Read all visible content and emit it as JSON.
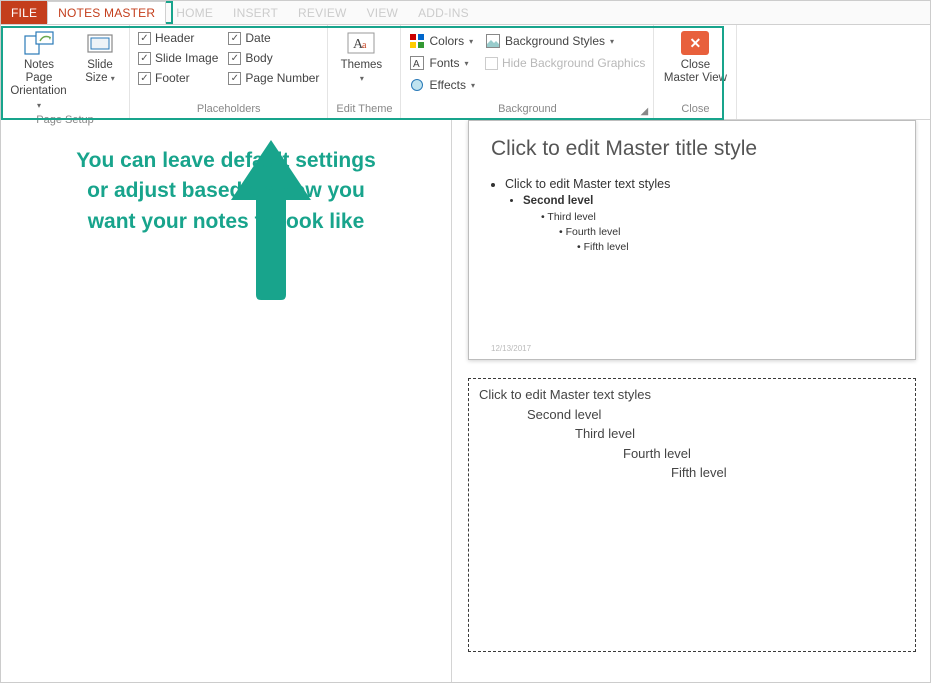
{
  "tabs": {
    "file": "FILE",
    "notes_master": "NOTES MASTER",
    "home": "HOME",
    "insert": "INSERT",
    "review": "REVIEW",
    "view": "VIEW",
    "addins": "ADD-INS"
  },
  "ribbon": {
    "page_setup": {
      "notes_orientation": "Notes Page Orientation",
      "slide_size": "Slide Size",
      "label": "Page Setup"
    },
    "placeholders": {
      "header": "Header",
      "slide_image": "Slide Image",
      "footer": "Footer",
      "date": "Date",
      "body": "Body",
      "page_number": "Page Number",
      "label": "Placeholders"
    },
    "edit_theme": {
      "themes": "Themes",
      "label": "Edit Theme"
    },
    "background": {
      "colors": "Colors",
      "fonts": "Fonts",
      "effects": "Effects",
      "bg_styles": "Background Styles",
      "hide_bg": "Hide Background Graphics",
      "label": "Background"
    },
    "close": {
      "close_master": "Close Master View",
      "label": "Close"
    }
  },
  "annotation": {
    "text": "You can leave default settings or adjust based on how you want your notes to look like"
  },
  "slide": {
    "title": "Click to edit Master title style",
    "body_l1": "Click to edit Master text styles",
    "body_l2": "Second level",
    "body_l3": "Third level",
    "body_l4": "Fourth level",
    "body_l5": "Fifth level",
    "date": "12/13/2017"
  },
  "notes": {
    "l1": "Click to edit Master text styles",
    "l2": "Second level",
    "l3": "Third level",
    "l4": "Fourth level",
    "l5": "Fifth level"
  }
}
